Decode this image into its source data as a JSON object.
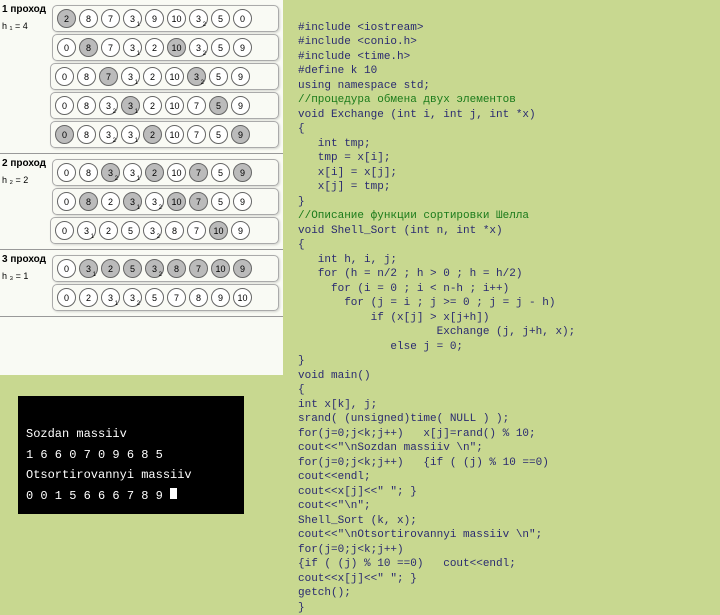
{
  "passes": [
    {
      "title": "1 проход",
      "sub": "h ₁ = 4",
      "rows": [
        [
          [
            2,
            "",
            1
          ],
          [
            8,
            "",
            0
          ],
          [
            7,
            "",
            0
          ],
          [
            3,
            "1",
            0
          ],
          [
            9,
            "",
            0
          ],
          [
            10,
            "",
            0
          ],
          [
            3,
            "2",
            0
          ],
          [
            5,
            "",
            0
          ],
          [
            0,
            "",
            0
          ]
        ],
        [
          [
            0,
            "",
            0
          ],
          [
            8,
            "",
            1
          ],
          [
            7,
            "",
            0
          ],
          [
            3,
            "1",
            0
          ],
          [
            2,
            "",
            0
          ],
          [
            10,
            "",
            1
          ],
          [
            3,
            "2",
            0
          ],
          [
            5,
            "",
            0
          ],
          [
            9,
            "",
            0
          ]
        ],
        [
          [
            0,
            "",
            0
          ],
          [
            8,
            "",
            0
          ],
          [
            7,
            "",
            1
          ],
          [
            3,
            "1",
            0
          ],
          [
            2,
            "",
            0
          ],
          [
            10,
            "",
            0
          ],
          [
            3,
            "2",
            1
          ],
          [
            5,
            "",
            0
          ],
          [
            9,
            "",
            0
          ]
        ],
        [
          [
            0,
            "",
            0
          ],
          [
            8,
            "",
            0
          ],
          [
            3,
            "2",
            0
          ],
          [
            3,
            "1",
            1
          ],
          [
            2,
            "",
            0
          ],
          [
            10,
            "",
            0
          ],
          [
            7,
            "",
            0
          ],
          [
            5,
            "",
            1
          ],
          [
            9,
            "",
            0
          ]
        ],
        [
          [
            0,
            "",
            1
          ],
          [
            8,
            "",
            0
          ],
          [
            3,
            "2",
            0
          ],
          [
            3,
            "1",
            0
          ],
          [
            2,
            "",
            1
          ],
          [
            10,
            "",
            0
          ],
          [
            7,
            "",
            0
          ],
          [
            5,
            "",
            0
          ],
          [
            9,
            "",
            1
          ]
        ]
      ]
    },
    {
      "title": "2 проход",
      "sub": "h ₂ = 2",
      "rows": [
        [
          [
            0,
            "",
            0
          ],
          [
            8,
            "",
            0
          ],
          [
            3,
            "2",
            1
          ],
          [
            3,
            "1",
            0
          ],
          [
            2,
            "",
            1
          ],
          [
            10,
            "",
            0
          ],
          [
            7,
            "",
            1
          ],
          [
            5,
            "",
            0
          ],
          [
            9,
            "",
            1
          ]
        ],
        [
          [
            0,
            "",
            0
          ],
          [
            8,
            "",
            1
          ],
          [
            2,
            "",
            0
          ],
          [
            3,
            "1",
            1
          ],
          [
            3,
            "2",
            0
          ],
          [
            10,
            "",
            1
          ],
          [
            7,
            "",
            1
          ],
          [
            5,
            "",
            0
          ],
          [
            9,
            "",
            0
          ]
        ],
        [
          [
            0,
            "",
            0
          ],
          [
            3,
            "1",
            0
          ],
          [
            2,
            "",
            0
          ],
          [
            5,
            "",
            0
          ],
          [
            3,
            "2",
            0
          ],
          [
            8,
            "",
            0
          ],
          [
            7,
            "",
            0
          ],
          [
            10,
            "",
            1
          ],
          [
            9,
            "",
            0
          ]
        ]
      ]
    },
    {
      "title": "3 проход",
      "sub": "h ₃ = 1",
      "rows": [
        [
          [
            0,
            "",
            0
          ],
          [
            3,
            "1",
            1
          ],
          [
            2,
            "",
            1
          ],
          [
            5,
            "",
            1
          ],
          [
            3,
            "2",
            1
          ],
          [
            8,
            "",
            1
          ],
          [
            7,
            "",
            1
          ],
          [
            10,
            "",
            1
          ],
          [
            9,
            "",
            1
          ]
        ],
        [
          [
            0,
            "",
            0
          ],
          [
            2,
            "",
            0
          ],
          [
            3,
            "1",
            0
          ],
          [
            3,
            "2",
            0
          ],
          [
            5,
            "",
            0
          ],
          [
            7,
            "",
            0
          ],
          [
            8,
            "",
            0
          ],
          [
            9,
            "",
            0
          ],
          [
            10,
            "",
            0
          ]
        ]
      ]
    }
  ],
  "console": {
    "l1": "Sozdan massiiv",
    "l2": "1 6 6 0 7 0 9 6 8 5",
    "l3": "Otsortirovannyi massiiv",
    "l4": "0 0 1 5 6 6 6 7 8 9 "
  },
  "code": {
    "c1": "#include <iostream>",
    "c2": "#include <conio.h>",
    "c3": "#include <time.h>",
    "c4": "#define k 10",
    "c5": "using namespace std;",
    "c6": "//процедура обмена двух элементов",
    "c7": "void Exchange (int i, int j, int *x)",
    "c8": "{",
    "c9": "   int tmp;",
    "c10": "   tmp = x[i];",
    "c11": "   x[i] = x[j];",
    "c12": "   x[j] = tmp;",
    "c13": "}",
    "c14": "//Описание функции сортировки Шелла",
    "c15": "void Shell_Sort (int n, int *x)",
    "c16": "{",
    "c17": "   int h, i, j;",
    "c18": "   for (h = n/2 ; h > 0 ; h = h/2)",
    "c19": "     for (i = 0 ; i < n-h ; i++)",
    "c20": "       for (j = i ; j >= 0 ; j = j - h)",
    "c21": "           if (x[j] > x[j+h])",
    "c22": "                     Exchange (j, j+h, x);",
    "c23": "              else j = 0;",
    "c24": "}",
    "c25": "void main()",
    "c26": "{",
    "c27": "int x[k], j;",
    "c28": "srand( (unsigned)time( NULL ) );",
    "c29": "for(j=0;j<k;j++)   x[j]=rand() % 10;",
    "c30": "cout<<\"\\nSozdan massiiv \\n\";",
    "c31": "for(j=0;j<k;j++)   {if ( (j) % 10 ==0)",
    "c32": "cout<<endl;",
    "c33": "cout<<x[j]<<\" \"; }",
    "c34": "cout<<\"\\n\";",
    "c35": "Shell_Sort (k, x);",
    "c36": "cout<<\"\\nOtsortirovannyi massiiv \\n\";",
    "c37": "for(j=0;j<k;j++)",
    "c38": "{if ( (j) % 10 ==0)   cout<<endl;",
    "c39": "cout<<x[j]<<\" \"; }",
    "c40": "getch();",
    "c41": "}"
  }
}
